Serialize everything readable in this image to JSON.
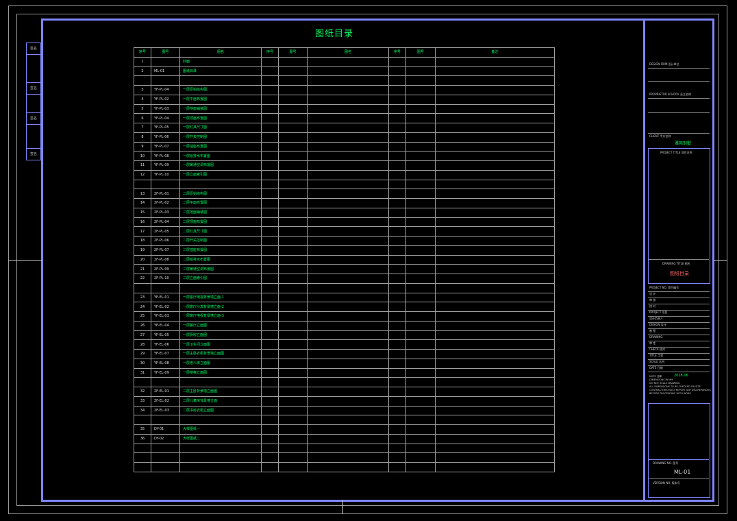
{
  "sheet_title": "图纸目录",
  "table": {
    "headers": [
      "序号",
      "图号",
      "图名",
      "序号",
      "图号",
      "图名",
      "序号",
      "图号",
      "备注"
    ],
    "rows": [
      [
        "1",
        "",
        "封面"
      ],
      [
        "2",
        "ML-01",
        "图纸目录"
      ],
      [
        "",
        "",
        ""
      ],
      [
        "3",
        "YF-PL-04",
        "一层原始结构图"
      ],
      [
        "4",
        "YF-PL-02",
        "一层平面布置图"
      ],
      [
        "5",
        "YF-PL-03",
        "一层地面铺装图"
      ],
      [
        "6",
        "YF-PL-04",
        "一层顶面布置图"
      ],
      [
        "7",
        "YF-PL-05",
        "一层灯具尺寸图"
      ],
      [
        "8",
        "YF-PL-06",
        "一层开关控制图"
      ],
      [
        "9",
        "YF-PL-07",
        "一层插座布置图"
      ],
      [
        "10",
        "YF-PL-08",
        "一层给排水布置图"
      ],
      [
        "11",
        "YF-PL-09",
        "一层暖通空调布置图"
      ],
      [
        "12",
        "YF-PL-10",
        "一层立面索引图"
      ],
      [
        "",
        "",
        ""
      ],
      [
        "13",
        "2F-PL-01",
        "二层原始结构图"
      ],
      [
        "14",
        "2F-PL-02",
        "二层平面布置图"
      ],
      [
        "15",
        "2F-PL-03",
        "二层地面铺装图"
      ],
      [
        "16",
        "2F-PL-04",
        "二层顶面布置图"
      ],
      [
        "17",
        "2F-PL-05",
        "二层灯具尺寸图"
      ],
      [
        "18",
        "2F-PL-06",
        "二层开关控制图"
      ],
      [
        "19",
        "2F-PL-07",
        "二层插座布置图"
      ],
      [
        "20",
        "2F-PL-08",
        "二层给排水布置图"
      ],
      [
        "21",
        "2F-PL-09",
        "二层暖通空调布置图"
      ],
      [
        "22",
        "2F-PL-10",
        "二层立面索引图"
      ],
      [
        "",
        "",
        ""
      ],
      [
        "23",
        "YF-EL-01",
        "一层客厅电视背景墙立面-1"
      ],
      [
        "24",
        "YF-EL-02",
        "一层客厅沙发背景墙立面-2"
      ],
      [
        "25",
        "YF-EL-03",
        "一层客厅电视背景墙立面-3"
      ],
      [
        "26",
        "YF-EL-04",
        "一层餐厅立面图"
      ],
      [
        "27",
        "YF-EL-05",
        "一层厨房立面图"
      ],
      [
        "28",
        "YF-EL-06",
        "一层卫生间立面图"
      ],
      [
        "29",
        "YF-EL-07",
        "一层主卧衣柜背景墙立面图"
      ],
      [
        "30",
        "YF-EL-08",
        "一层老人房立面图"
      ],
      [
        "31",
        "YF-EL-09",
        "一层楼梯立面图"
      ],
      [
        "",
        "",
        ""
      ],
      [
        "32",
        "2F-EL-01",
        "二层主卧背景墙立面图"
      ],
      [
        "33",
        "2F-EL-02",
        "二层儿童房背景墙立面"
      ],
      [
        "34",
        "2F-EL-03",
        "二层书房衣柜立面图"
      ],
      [
        "",
        "",
        ""
      ],
      [
        "35",
        "DY-01",
        "大样图纸一"
      ],
      [
        "36",
        "DY-02",
        "大样图纸二"
      ],
      [
        "",
        "",
        ""
      ],
      [
        "",
        "",
        ""
      ],
      [
        "",
        "",
        ""
      ]
    ]
  },
  "side_panel": [
    "签名",
    "日期",
    "签名",
    "日期",
    "签名",
    "日期",
    "签名",
    "日期"
  ],
  "title_block": {
    "design_firm": "DESIGN FIRM 设计单位",
    "proprietor": "PROPRIETOR SCHOOL 业主名称",
    "client_title": "CLIENT 甲方名称",
    "client_name": "雅苑别墅",
    "project_label": "PROJECT TITLE 项目名称",
    "drawing_title_label": "DRAWING TITLE 图名",
    "drawing_title": "图纸目录",
    "rows": [
      "PROJECT NO. 项目编号",
      "设 计",
      "审 核",
      "校 对",
      "PROJECT 项目",
      "设计负责人",
      "DESIGN 设计",
      "制 图",
      "DRAWING",
      "审 定",
      "CHECK 校对",
      "TITLE 工程",
      "SCALE 比例",
      "DATE 日期"
    ],
    "date_value": "2018.06",
    "notes": [
      "NOTE 注释",
      "DIMENSIONS IN MM",
      "DO NOT SCALE DRAWING",
      "ALL DIMENSIONS TO BE CHECKED ON SITE",
      "CONTRACTORS MUST REPORT ANY DISCREPANCIES",
      "BEFORE PROCEEDING WITH WORK"
    ],
    "drawing_no_label": "DRAWING NO. 图号",
    "drawing_no": "ML-01",
    "version_label": "VERSION NO. 版本号"
  }
}
